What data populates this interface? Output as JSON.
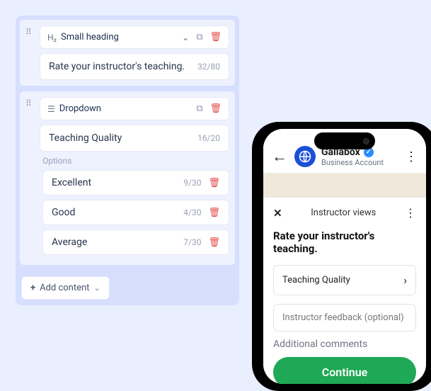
{
  "editor": {
    "block1": {
      "type_icon": "H₂",
      "type_label": "Small heading",
      "text": "Rate your instructor's teaching.",
      "counter": "32/80"
    },
    "block2": {
      "type_label": "Dropdown",
      "title": "Teaching Quality",
      "title_counter": "16/20",
      "options_label": "Options",
      "options": [
        {
          "text": "Excellent",
          "counter": "9/30"
        },
        {
          "text": "Good",
          "counter": "4/30"
        },
        {
          "text": "Average",
          "counter": "7/30"
        }
      ]
    },
    "add_content": "Add content"
  },
  "phone": {
    "name": "Gallabox",
    "subtitle": "Business Account",
    "sheet_title": "Instructor views",
    "prompt": "Rate your instructor's teaching.",
    "select_label": "Teaching Quality",
    "textbox_placeholder": "Instructor feedback (optional)",
    "additional": "Additional comments",
    "cta": "Continue"
  }
}
